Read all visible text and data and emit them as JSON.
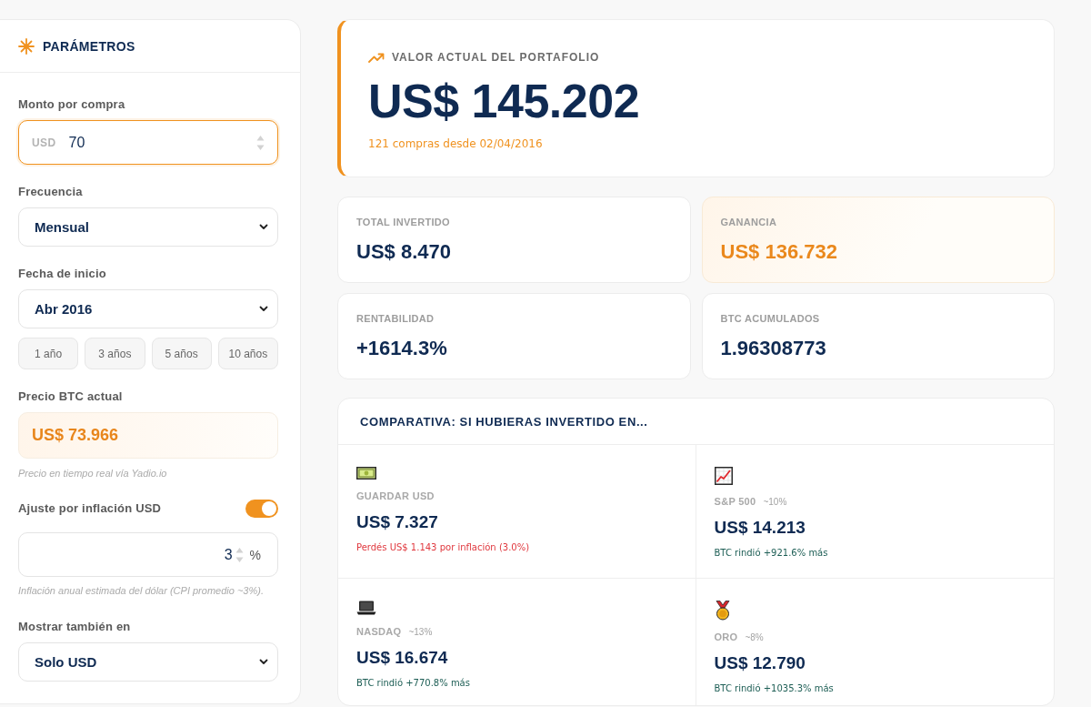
{
  "parameters": {
    "title": "PARÁMETROS",
    "amount": {
      "label": "Monto por compra",
      "prefix": "USD",
      "value": "70",
      "focused": true
    },
    "frequency": {
      "label": "Frecuencia",
      "value": "Mensual"
    },
    "start_date": {
      "label": "Fecha de inicio",
      "value": "Abr 2016",
      "presets": [
        {
          "label": "1 año",
          "selected": false
        },
        {
          "label": "3 años",
          "selected": false
        },
        {
          "label": "5 años",
          "selected": false
        },
        {
          "label": "10 años",
          "selected": false
        }
      ]
    },
    "btc_price": {
      "label": "Precio BTC actual",
      "value": "US$ 73.966",
      "note": "Precio en tiempo real vía Yadio.io"
    },
    "inflation": {
      "label": "Ajuste por inflación USD",
      "on": true,
      "value": "3",
      "unit": "%",
      "note": "Inflación anual estimada del dólar (CPI promedio ~3%)."
    },
    "display_currency": {
      "label": "Mostrar también en",
      "value": "Solo USD"
    }
  },
  "portfolio": {
    "label": "VALOR ACTUAL DEL PORTAFOLIO",
    "value": "US$ 145.202",
    "subtitle": "121 compras desde 02/04/2016"
  },
  "stats": [
    {
      "label": "TOTAL INVERTIDO",
      "value": "US$ 8.470",
      "highlighted": false
    },
    {
      "label": "GANANCIA",
      "value": "US$ 136.732",
      "highlighted": true
    },
    {
      "label": "RENTABILIDAD",
      "value": "+1614.3%",
      "highlighted": false
    },
    {
      "label": "BTC ACUMULADOS",
      "value": "1.96308773",
      "highlighted": false
    }
  ],
  "comparison": {
    "title": "COMPARATIVA: SI HUBIERAS INVERTIDO EN...",
    "items": [
      {
        "kind": "cash",
        "name": "GUARDAR USD",
        "value": "US$ 7.327",
        "message": "Perdés US$ 1.143 por inflación (3.0%)",
        "loss": true
      },
      {
        "kind": "stocks",
        "name": "S&P 500",
        "rate": "~10%",
        "value": "US$ 14.213",
        "message": "BTC rindió +921.6% más",
        "loss": false
      },
      {
        "kind": "tech",
        "name": "NASDAQ",
        "rate": "~13%",
        "value": "US$ 16.674",
        "message": "BTC rindió +770.8% más",
        "loss": false
      },
      {
        "kind": "gold",
        "name": "ORO",
        "rate": "~8%",
        "value": "US$ 12.790",
        "message": "BTC rindió +1035.3% más",
        "loss": false
      }
    ]
  }
}
